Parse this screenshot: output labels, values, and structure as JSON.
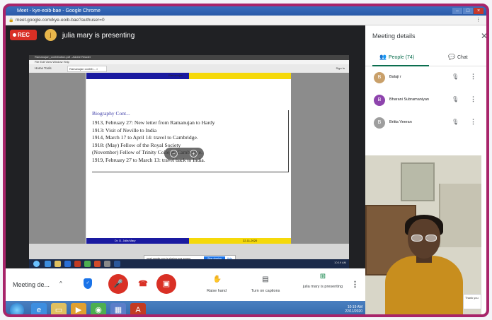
{
  "browser": {
    "title": "Meet - kye-eoib-bae - Google Chrome",
    "url": "meet.google.com/kye-eoib-bae?authuser=0"
  },
  "meet": {
    "rec_label": "REC",
    "presenter_text": "julia mary is presenting",
    "presenter_initial": "j"
  },
  "shared_screen": {
    "window_title": "Ramanujan_contribution.pdf - Adobe Reader",
    "menu_items": "File  Edit  View  Window  Help",
    "tabs": "Home  Tools",
    "doc_tab": "Ramanujan contrib... ×",
    "sign_in": "Sign In",
    "doc_header": "Ramanujan",
    "bio_title": "Biography Cont...",
    "bio_lines": [
      "1913, February 27: New letter from Ramanujan to Hardy",
      "1913: Visit of Neville to India",
      "1914, March 17 to April 14: travel to Cambridge.",
      "1918: (May) Fellow of the Royal Society",
      "(November) Fellow of Trinity College, Cambridge.",
      "1919, February 27 to March 13: travel back to India."
    ],
    "footer_left": "Dr. D. Julia Mary",
    "footer_right": "22-11-2020",
    "notification": "meet.google.com is sharing your screen.",
    "stop_sharing": "Stop sharing",
    "hide": "Hide",
    "taskbar_time": "10:19 AM"
  },
  "side_panel": {
    "title": "Meeting details",
    "tab_people": "People (74)",
    "tab_chat": "Chat",
    "people": [
      {
        "name": "Balaji r",
        "initial": "B",
        "color": "#c9a06a"
      },
      {
        "name": "Bharani Subramaniyan",
        "initial": "B",
        "color": "#8e44ad"
      },
      {
        "name": "Britta Veeran",
        "initial": "B",
        "color": "#9e9e9e"
      }
    ],
    "toast_text": "Thank you"
  },
  "controls": {
    "meeting_details": "Meeting de...",
    "raise_hand": "Raise hand",
    "captions": "Turn on captions",
    "presenting": "julia mary is presenting"
  },
  "taskbar": {
    "time": "10:19 AM",
    "date": "22/11/2020"
  }
}
